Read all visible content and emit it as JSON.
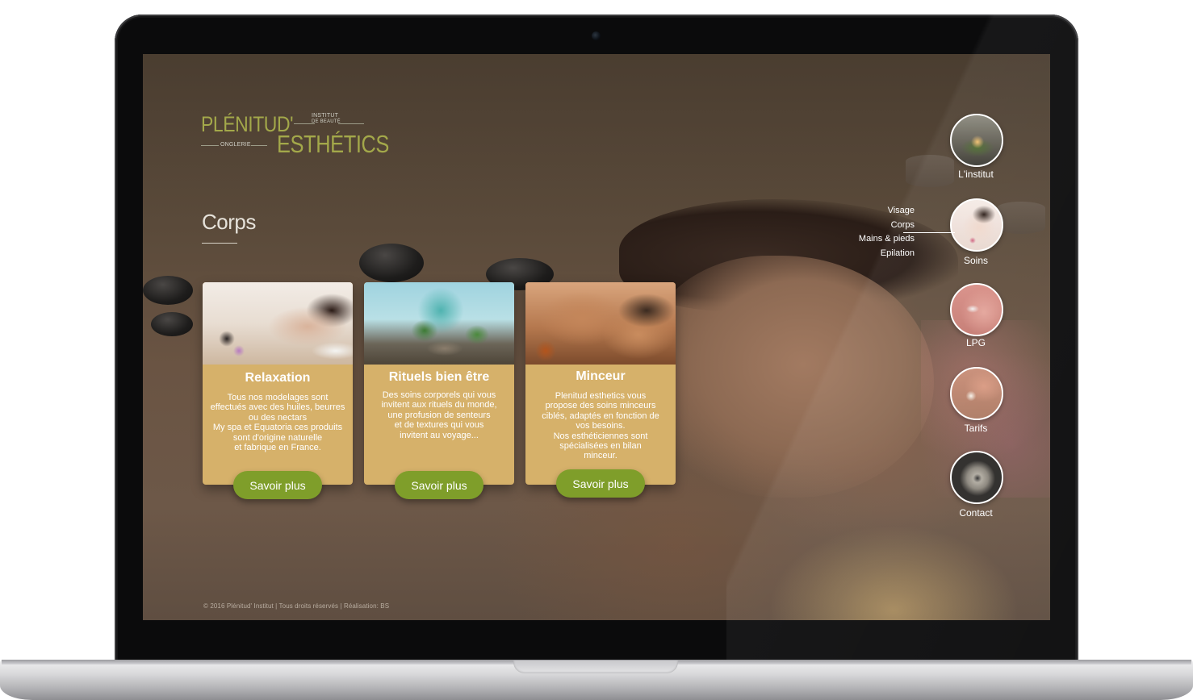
{
  "logo": {
    "line1": "PLÉNITUD'",
    "line2": "ESTHÉTICS",
    "tag_institut": "INSTITUT",
    "tag_beaute": "DE BEAUTÉ",
    "tag_onglerie": "ONGLERIE"
  },
  "section": {
    "title": "Corps"
  },
  "cards": [
    {
      "title": "Relaxation",
      "text": "Tous nos modelages sont\neffectués avec des huiles, beurres\nou des nectars\nMy spa et Equatoria ces produits\nsont d'origine naturelle\net fabrique en France.",
      "button": "Savoir plus"
    },
    {
      "title": "Rituels bien être",
      "text": "Des soins corporels qui vous\ninvitent aux rituels du monde,\nune profusion de senteurs\net de textures qui vous\ninvitent au voyage...",
      "button": "Savoir plus"
    },
    {
      "title": "Minceur",
      "text": "Plenitud esthetics vous\npropose des soins minceurs\nciblés, adaptés en fonction de\nvos besoins.\nNos esthéticiennes sont\nspécialisées en bilan\nminceur.",
      "button": "Savoir plus"
    }
  ],
  "nav": [
    {
      "label": "L'institut",
      "icon": "institut-icon"
    },
    {
      "label": "Soins",
      "icon": "soins-icon"
    },
    {
      "label": "LPG",
      "icon": "lpg-icon"
    },
    {
      "label": "Tarifs",
      "icon": "tarifs-icon"
    },
    {
      "label": "Contact",
      "icon": "contact-icon"
    }
  ],
  "submenu": [
    "Visage",
    "Corps",
    "Mains & pieds",
    "Epilation"
  ],
  "footer": "© 2016 Plénitud' Institut | Tous droits réservés | Réalisation: BS",
  "colors": {
    "accent_green": "#7f9e2a",
    "card_gold": "#d6b16a",
    "logo_olive": "#a3a84a"
  }
}
